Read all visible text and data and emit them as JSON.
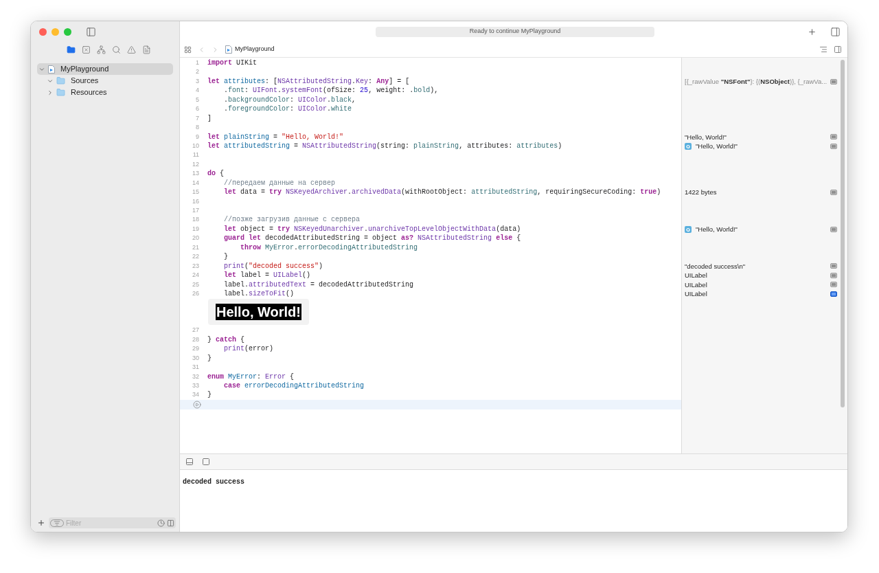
{
  "toolbar": {
    "status": "Ready to continue MyPlayground"
  },
  "navigator_tabs": [
    {
      "kind": "project",
      "selected": true
    },
    {
      "kind": "source-control",
      "selected": false
    },
    {
      "kind": "symbols",
      "selected": false
    },
    {
      "kind": "find",
      "selected": false
    },
    {
      "kind": "issues",
      "selected": false
    },
    {
      "kind": "reports",
      "selected": false
    }
  ],
  "sidebar": {
    "items": [
      {
        "label": "MyPlayground",
        "expanded": true,
        "selected": true,
        "children": [
          {
            "label": "Sources",
            "expanded": true,
            "selected": false
          },
          {
            "label": "Resources",
            "expanded": false,
            "selected": false
          }
        ]
      }
    ],
    "filter": {
      "placeholder": "Filter"
    }
  },
  "breadcrumb": {
    "label": "MyPlayground"
  },
  "editor": {
    "lines": [
      {
        "number": "1",
        "tokens": [
          {
            "kind": "keyword",
            "text": "import"
          },
          {
            "kind": "plain",
            "text": " UIKit"
          }
        ]
      },
      {
        "number": "2"
      },
      {
        "number": "3",
        "tokens": [
          {
            "kind": "keyword",
            "text": "let"
          },
          {
            "kind": "decl",
            "text": " attributes"
          },
          {
            "kind": "plain",
            "text": ": ["
          },
          {
            "kind": "type",
            "text": "NSAttributedString"
          },
          {
            "kind": "plain",
            "text": "."
          },
          {
            "kind": "type",
            "text": "Key"
          },
          {
            "kind": "plain",
            "text": ": "
          },
          {
            "kind": "keyword",
            "text": "Any"
          },
          {
            "kind": "plain",
            "text": "] = ["
          }
        ],
        "result": {
          "text": "[{_rawValue **\"NSFont\"**}: {(**NSObject**)}, {_rawVa...",
          "kind": "dump",
          "selected": false
        }
      },
      {
        "number": "4",
        "tokens": [
          {
            "kind": "plain",
            "text": "    ."
          },
          {
            "kind": "member",
            "text": "font"
          },
          {
            "kind": "plain",
            "text": ": "
          },
          {
            "kind": "type",
            "text": "UIFont"
          },
          {
            "kind": "plain",
            "text": "."
          },
          {
            "kind": "type",
            "text": "systemFont"
          },
          {
            "kind": "plain",
            "text": "(ofSize: "
          },
          {
            "kind": "number",
            "text": "25"
          },
          {
            "kind": "plain",
            "text": ", weight: ."
          },
          {
            "kind": "member",
            "text": "bold"
          },
          {
            "kind": "plain",
            "text": "),"
          }
        ]
      },
      {
        "number": "5",
        "tokens": [
          {
            "kind": "plain",
            "text": "    ."
          },
          {
            "kind": "member",
            "text": "backgroundColor"
          },
          {
            "kind": "plain",
            "text": ": "
          },
          {
            "kind": "type",
            "text": "UIColor"
          },
          {
            "kind": "plain",
            "text": "."
          },
          {
            "kind": "member",
            "text": "black"
          },
          {
            "kind": "plain",
            "text": ","
          }
        ]
      },
      {
        "number": "6",
        "tokens": [
          {
            "kind": "plain",
            "text": "    ."
          },
          {
            "kind": "member",
            "text": "foregroundColor"
          },
          {
            "kind": "plain",
            "text": ": "
          },
          {
            "kind": "type",
            "text": "UIColor"
          },
          {
            "kind": "plain",
            "text": "."
          },
          {
            "kind": "member",
            "text": "white"
          }
        ]
      },
      {
        "number": "7",
        "tokens": [
          {
            "kind": "plain",
            "text": "]"
          }
        ]
      },
      {
        "number": "8"
      },
      {
        "number": "9",
        "tokens": [
          {
            "kind": "keyword",
            "text": "let"
          },
          {
            "kind": "decl",
            "text": " plainString"
          },
          {
            "kind": "plain",
            "text": " = "
          },
          {
            "kind": "string",
            "text": "\"Hello, World!\""
          }
        ],
        "result": {
          "text": "\"Hello, World!\"",
          "kind": "value",
          "selected": false
        }
      },
      {
        "number": "10",
        "tokens": [
          {
            "kind": "keyword",
            "text": "let"
          },
          {
            "kind": "decl",
            "text": " attributedString"
          },
          {
            "kind": "plain",
            "text": " = "
          },
          {
            "kind": "type",
            "text": "NSAttributedString"
          },
          {
            "kind": "plain",
            "text": "(string: "
          },
          {
            "kind": "member",
            "text": "plainString"
          },
          {
            "kind": "plain",
            "text": ", attributes: "
          },
          {
            "kind": "member",
            "text": "attributes"
          },
          {
            "kind": "plain",
            "text": ")"
          }
        ],
        "result": {
          "text": "\"Hello, World!\"",
          "kind": "attributed",
          "selected": false
        }
      },
      {
        "number": "11"
      },
      {
        "number": "12"
      },
      {
        "number": "13",
        "tokens": [
          {
            "kind": "keyword",
            "text": "do"
          },
          {
            "kind": "plain",
            "text": " {"
          }
        ]
      },
      {
        "number": "14",
        "tokens": [
          {
            "kind": "comment",
            "text": "    //передаем данные на сервер"
          }
        ]
      },
      {
        "number": "15",
        "tokens": [
          {
            "kind": "keyword",
            "text": "    let"
          },
          {
            "kind": "plain",
            "text": " data = "
          },
          {
            "kind": "keyword",
            "text": "try"
          },
          {
            "kind": "type",
            "text": " NSKeyedArchiver"
          },
          {
            "kind": "plain",
            "text": "."
          },
          {
            "kind": "type",
            "text": "archivedData"
          },
          {
            "kind": "plain",
            "text": "(withRootObject: "
          },
          {
            "kind": "member",
            "text": "attributedString"
          },
          {
            "kind": "plain",
            "text": ", requiringSecureCoding: "
          },
          {
            "kind": "keyword",
            "text": "true"
          },
          {
            "kind": "plain",
            "text": ")"
          }
        ],
        "result": {
          "text": "1422 bytes",
          "kind": "value",
          "selected": false
        }
      },
      {
        "number": "16"
      },
      {
        "number": "17"
      },
      {
        "number": "18",
        "tokens": [
          {
            "kind": "comment",
            "text": "    //позже загрузив данные с сервера"
          }
        ]
      },
      {
        "number": "19",
        "tokens": [
          {
            "kind": "keyword",
            "text": "    let"
          },
          {
            "kind": "plain",
            "text": " object = "
          },
          {
            "kind": "keyword",
            "text": "try"
          },
          {
            "kind": "type",
            "text": " NSKeyedUnarchiver"
          },
          {
            "kind": "plain",
            "text": "."
          },
          {
            "kind": "type",
            "text": "unarchiveTopLevelObjectWithData"
          },
          {
            "kind": "plain",
            "text": "(data)"
          }
        ],
        "result": {
          "text": "\"Hello, World!\"",
          "kind": "attributed",
          "selected": false
        }
      },
      {
        "number": "20",
        "tokens": [
          {
            "kind": "keyword",
            "text": "    guard"
          },
          {
            "kind": "keyword",
            "text": " let"
          },
          {
            "kind": "plain",
            "text": " decodedAttributedString = object "
          },
          {
            "kind": "keyword",
            "text": "as?"
          },
          {
            "kind": "type",
            "text": " NSAttributedString"
          },
          {
            "kind": "keyword",
            "text": " else"
          },
          {
            "kind": "plain",
            "text": " {"
          }
        ]
      },
      {
        "number": "21",
        "tokens": [
          {
            "kind": "keyword",
            "text": "        throw"
          },
          {
            "kind": "member",
            "text": " MyError"
          },
          {
            "kind": "plain",
            "text": "."
          },
          {
            "kind": "member",
            "text": "errorDecodingAttributedString"
          }
        ]
      },
      {
        "number": "22",
        "tokens": [
          {
            "kind": "plain",
            "text": "    }"
          }
        ]
      },
      {
        "number": "23",
        "tokens": [
          {
            "kind": "type",
            "text": "    print"
          },
          {
            "kind": "plain",
            "text": "("
          },
          {
            "kind": "string",
            "text": "\"decoded success\""
          },
          {
            "kind": "plain",
            "text": ")"
          }
        ],
        "result": {
          "text": "\"decoded success\\n\"",
          "kind": "value",
          "selected": false
        }
      },
      {
        "number": "24",
        "tokens": [
          {
            "kind": "keyword",
            "text": "    let"
          },
          {
            "kind": "plain",
            "text": " label = "
          },
          {
            "kind": "type",
            "text": "UILabel"
          },
          {
            "kind": "plain",
            "text": "()"
          }
        ],
        "result": {
          "text": "UILabel",
          "kind": "value",
          "selected": false
        }
      },
      {
        "number": "25",
        "tokens": [
          {
            "kind": "plain",
            "text": "    label."
          },
          {
            "kind": "type",
            "text": "attributedText"
          },
          {
            "kind": "plain",
            "text": " = decodedAttributedString"
          }
        ],
        "result": {
          "text": "UILabel",
          "kind": "value",
          "selected": false
        }
      },
      {
        "number": "26",
        "tokens": [
          {
            "kind": "plain",
            "text": "    label."
          },
          {
            "kind": "type",
            "text": "sizeToFit"
          },
          {
            "kind": "plain",
            "text": "()"
          }
        ],
        "result": {
          "text": "UILabel",
          "kind": "value",
          "selected": true
        },
        "inline_result": {
          "text": "Hello, World!"
        }
      },
      {
        "number": "27"
      },
      {
        "number": "28",
        "tokens": [
          {
            "kind": "plain",
            "text": "} "
          },
          {
            "kind": "keyword",
            "text": "catch"
          },
          {
            "kind": "plain",
            "text": " {"
          }
        ]
      },
      {
        "number": "29",
        "tokens": [
          {
            "kind": "type",
            "text": "    print"
          },
          {
            "kind": "plain",
            "text": "(error)"
          }
        ]
      },
      {
        "number": "30",
        "tokens": [
          {
            "kind": "plain",
            "text": "}"
          }
        ]
      },
      {
        "number": "31"
      },
      {
        "number": "32",
        "tokens": [
          {
            "kind": "keyword",
            "text": "enum"
          },
          {
            "kind": "decl",
            "text": " MyError"
          },
          {
            "kind": "plain",
            "text": ": "
          },
          {
            "kind": "type",
            "text": "Error"
          },
          {
            "kind": "plain",
            "text": " {"
          }
        ]
      },
      {
        "number": "33",
        "tokens": [
          {
            "kind": "keyword",
            "text": "    case"
          },
          {
            "kind": "decl",
            "text": " errorDecodingAttributedString"
          }
        ]
      },
      {
        "number": "34",
        "tokens": [
          {
            "kind": "plain",
            "text": "}"
          }
        ]
      }
    ]
  },
  "console": {
    "output": "decoded success"
  }
}
